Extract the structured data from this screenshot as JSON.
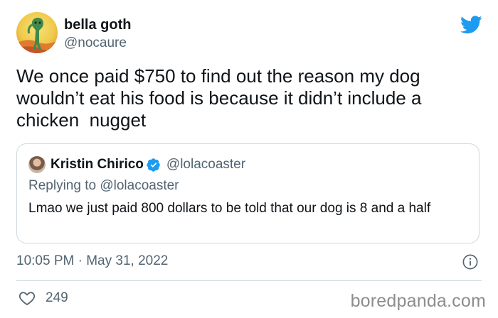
{
  "author": {
    "display_name": "bella goth",
    "handle": "@nocaure",
    "avatar_icon": "squidward-painting-avatar"
  },
  "tweet": {
    "text": "We once paid $750 to find out the reason my dog\nwouldn’t eat his food is because it didn’t include a\nchicken  nugget"
  },
  "quote": {
    "display_name": "Kristin Chirico",
    "verified_icon": "verified-badge-icon",
    "handle": "@lolacoaster",
    "replying_to": "Replying to @lolacoaster",
    "text": "Lmao we just paid 800 dollars to be told that our dog is 8 and a half"
  },
  "meta": {
    "timestamp": "10:05 PM · May 31, 2022",
    "like_count": "249"
  },
  "watermark": "boredpanda.com",
  "colors": {
    "twitter_blue": "#1d9bf0",
    "secondary_text": "#536471",
    "border": "#cfd9de",
    "watermark": "#8d8d8d"
  }
}
